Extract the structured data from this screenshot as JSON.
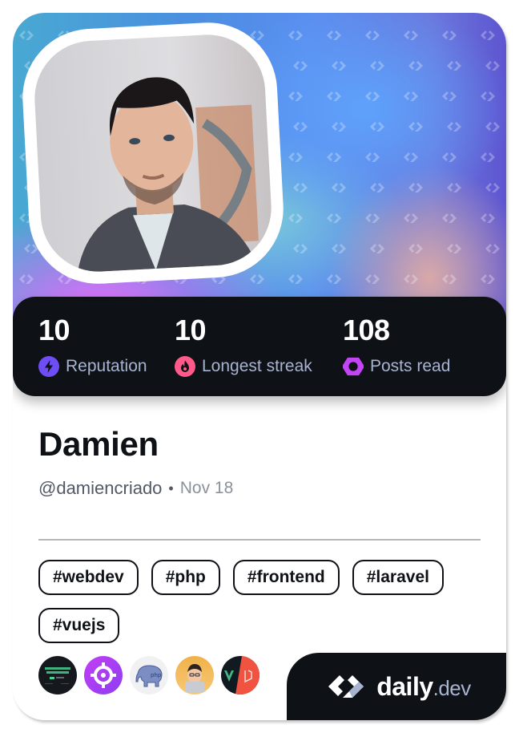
{
  "profile": {
    "name": "Damien",
    "handle": "@damiencriado",
    "separator": "•",
    "joined": "Nov 18"
  },
  "stats": [
    {
      "value": "10",
      "label": "Reputation",
      "icon": "lightning-icon",
      "color": "#6e4df5"
    },
    {
      "value": "10",
      "label": "Longest streak",
      "icon": "flame-icon",
      "color": "#ff5a8a"
    },
    {
      "value": "108",
      "label": "Posts read",
      "icon": "eye-ring-icon",
      "color": "#c445f5"
    }
  ],
  "tags": [
    "#webdev",
    "#php",
    "#frontend",
    "#laravel",
    "#vuejs"
  ],
  "sources": [
    {
      "name": "the-progressive-javascript-framework",
      "icon": "dark-site-thumbnail-icon"
    },
    {
      "name": "crosshair-source",
      "icon": "crosshair-icon",
      "color": "#b33ef5"
    },
    {
      "name": "php-elephant",
      "icon": "elephant-icon"
    },
    {
      "name": "devsquad",
      "icon": "memoji-laptop-icon"
    },
    {
      "name": "vue-laravel",
      "icon": "vue-laravel-icon"
    }
  ],
  "brand": {
    "name": "daily",
    "tld": ".dev"
  },
  "colors": {
    "dark": "#0e1116",
    "label": "#a8b3cf",
    "handle": "#525866",
    "date": "#8b919c"
  }
}
